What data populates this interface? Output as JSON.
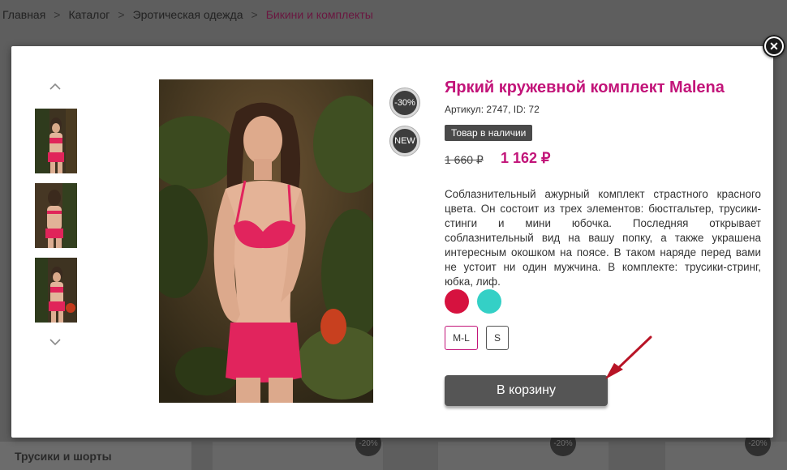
{
  "breadcrumb": {
    "home": "Главная",
    "sep1": ">",
    "catalog": "Каталог",
    "sep2": ">",
    "category": "Эротическая одежда",
    "sep3": ">",
    "current": "Бикини и комплекты"
  },
  "sidebar": {
    "visible_item": "Трусики и шорты"
  },
  "background_badges": [
    "-20%",
    "-20%",
    "-20%"
  ],
  "modal": {
    "close_symbol": "✕",
    "badges": {
      "discount": "-30%",
      "new": "NEW"
    },
    "product": {
      "title": "Яркий кружевной комплект Malena",
      "sku": "Артикул: 2747, ID: 72",
      "stock": "Товар в наличии",
      "old_price": "1 660 ₽",
      "price": "1 162 ₽",
      "description": "Соблазнительный ажурный комплект страстного красного цвета. Он состоит из трех элементов: бюстгальтер, трусики-стинги и мини юбочка. Последняя открывает соблазнительный вид на вашу попку, а также украшена интересным окошком на поясе. В таком наряде перед вами не устоит ни один мужчина. В комплекте: трусики-стринг, юбка, лиф.",
      "colors": [
        "#d6123f",
        "#34d0c6"
      ],
      "sizes": [
        {
          "label": "M-L",
          "selected": true
        },
        {
          "label": "S",
          "selected": false
        }
      ],
      "cart_button": "В корзину"
    },
    "gallery": {
      "up_icon": "chevron-up-icon",
      "down_icon": "chevron-down-icon",
      "thumbnail_count": 3
    }
  },
  "colors": {
    "accent": "#c21479",
    "button": "#555555",
    "annotation_arrow": "#b81426"
  }
}
